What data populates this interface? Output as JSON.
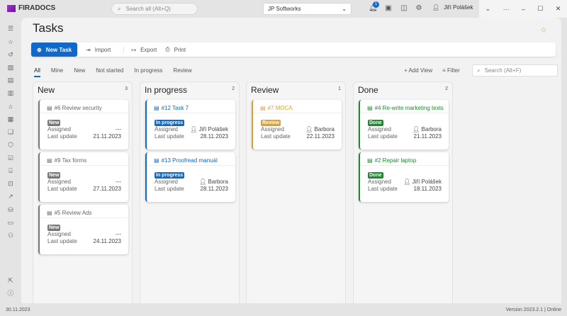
{
  "app": {
    "logo": "FIRADOCS",
    "search_placeholder": "Search all (Alt+Q)",
    "company": "JP Softworks",
    "notifications": "1",
    "user": "Jiří Polášek"
  },
  "page": {
    "title": "Tasks"
  },
  "toolbar": {
    "new": "New Task",
    "import": "Import",
    "export": "Export",
    "print": "Print"
  },
  "tabs": [
    "All",
    "Mine",
    "New",
    "Not started",
    "In progress",
    "Review"
  ],
  "controls": {
    "add_view": "Add View",
    "filter": "Filter",
    "search_placeholder": "Search (Alt+F)"
  },
  "labels": {
    "assigned": "Assigned",
    "last_update": "Last update"
  },
  "columns": [
    {
      "title": "New",
      "count": "3",
      "color": "#777777",
      "cards": [
        {
          "title": "#6 Review security",
          "status": "New",
          "assigned": "---",
          "date": "21.11.2023"
        },
        {
          "title": "#9 Tax forms",
          "status": "New",
          "assigned": "---",
          "date": "27.11.2023"
        },
        {
          "title": "#5 Review Ads",
          "status": "New",
          "assigned": "---",
          "date": "24.11.2023"
        }
      ]
    },
    {
      "title": "In progress",
      "count": "2",
      "color": "#1168c8",
      "cards": [
        {
          "title": "#12 Task 7",
          "status": "In progress",
          "assigned": "Jiří Polášek",
          "date": "28.11.2023"
        },
        {
          "title": "#13 Proofread manuál",
          "status": "In progress",
          "assigned": "Barbora",
          "date": "28.11.2023"
        }
      ]
    },
    {
      "title": "Review",
      "count": "1",
      "color": "#e0a030",
      "cards": [
        {
          "title": "#7 MOCA",
          "status": "Review",
          "assigned": "Barbora",
          "date": "22.11.2023"
        }
      ]
    },
    {
      "title": "Done",
      "count": "2",
      "color": "#1e8a2e",
      "cards": [
        {
          "title": "#4 Re-write marketing texts",
          "status": "Done",
          "assigned": "Barbora",
          "date": "21.11.2023"
        },
        {
          "title": "#2 Repair laptop",
          "status": "Done",
          "assigned": "Jiří Polášek",
          "date": "18.11.2023"
        }
      ]
    }
  ],
  "footer": {
    "date": "30.11.2023",
    "version": "Version 2023.2.1 | Online"
  }
}
